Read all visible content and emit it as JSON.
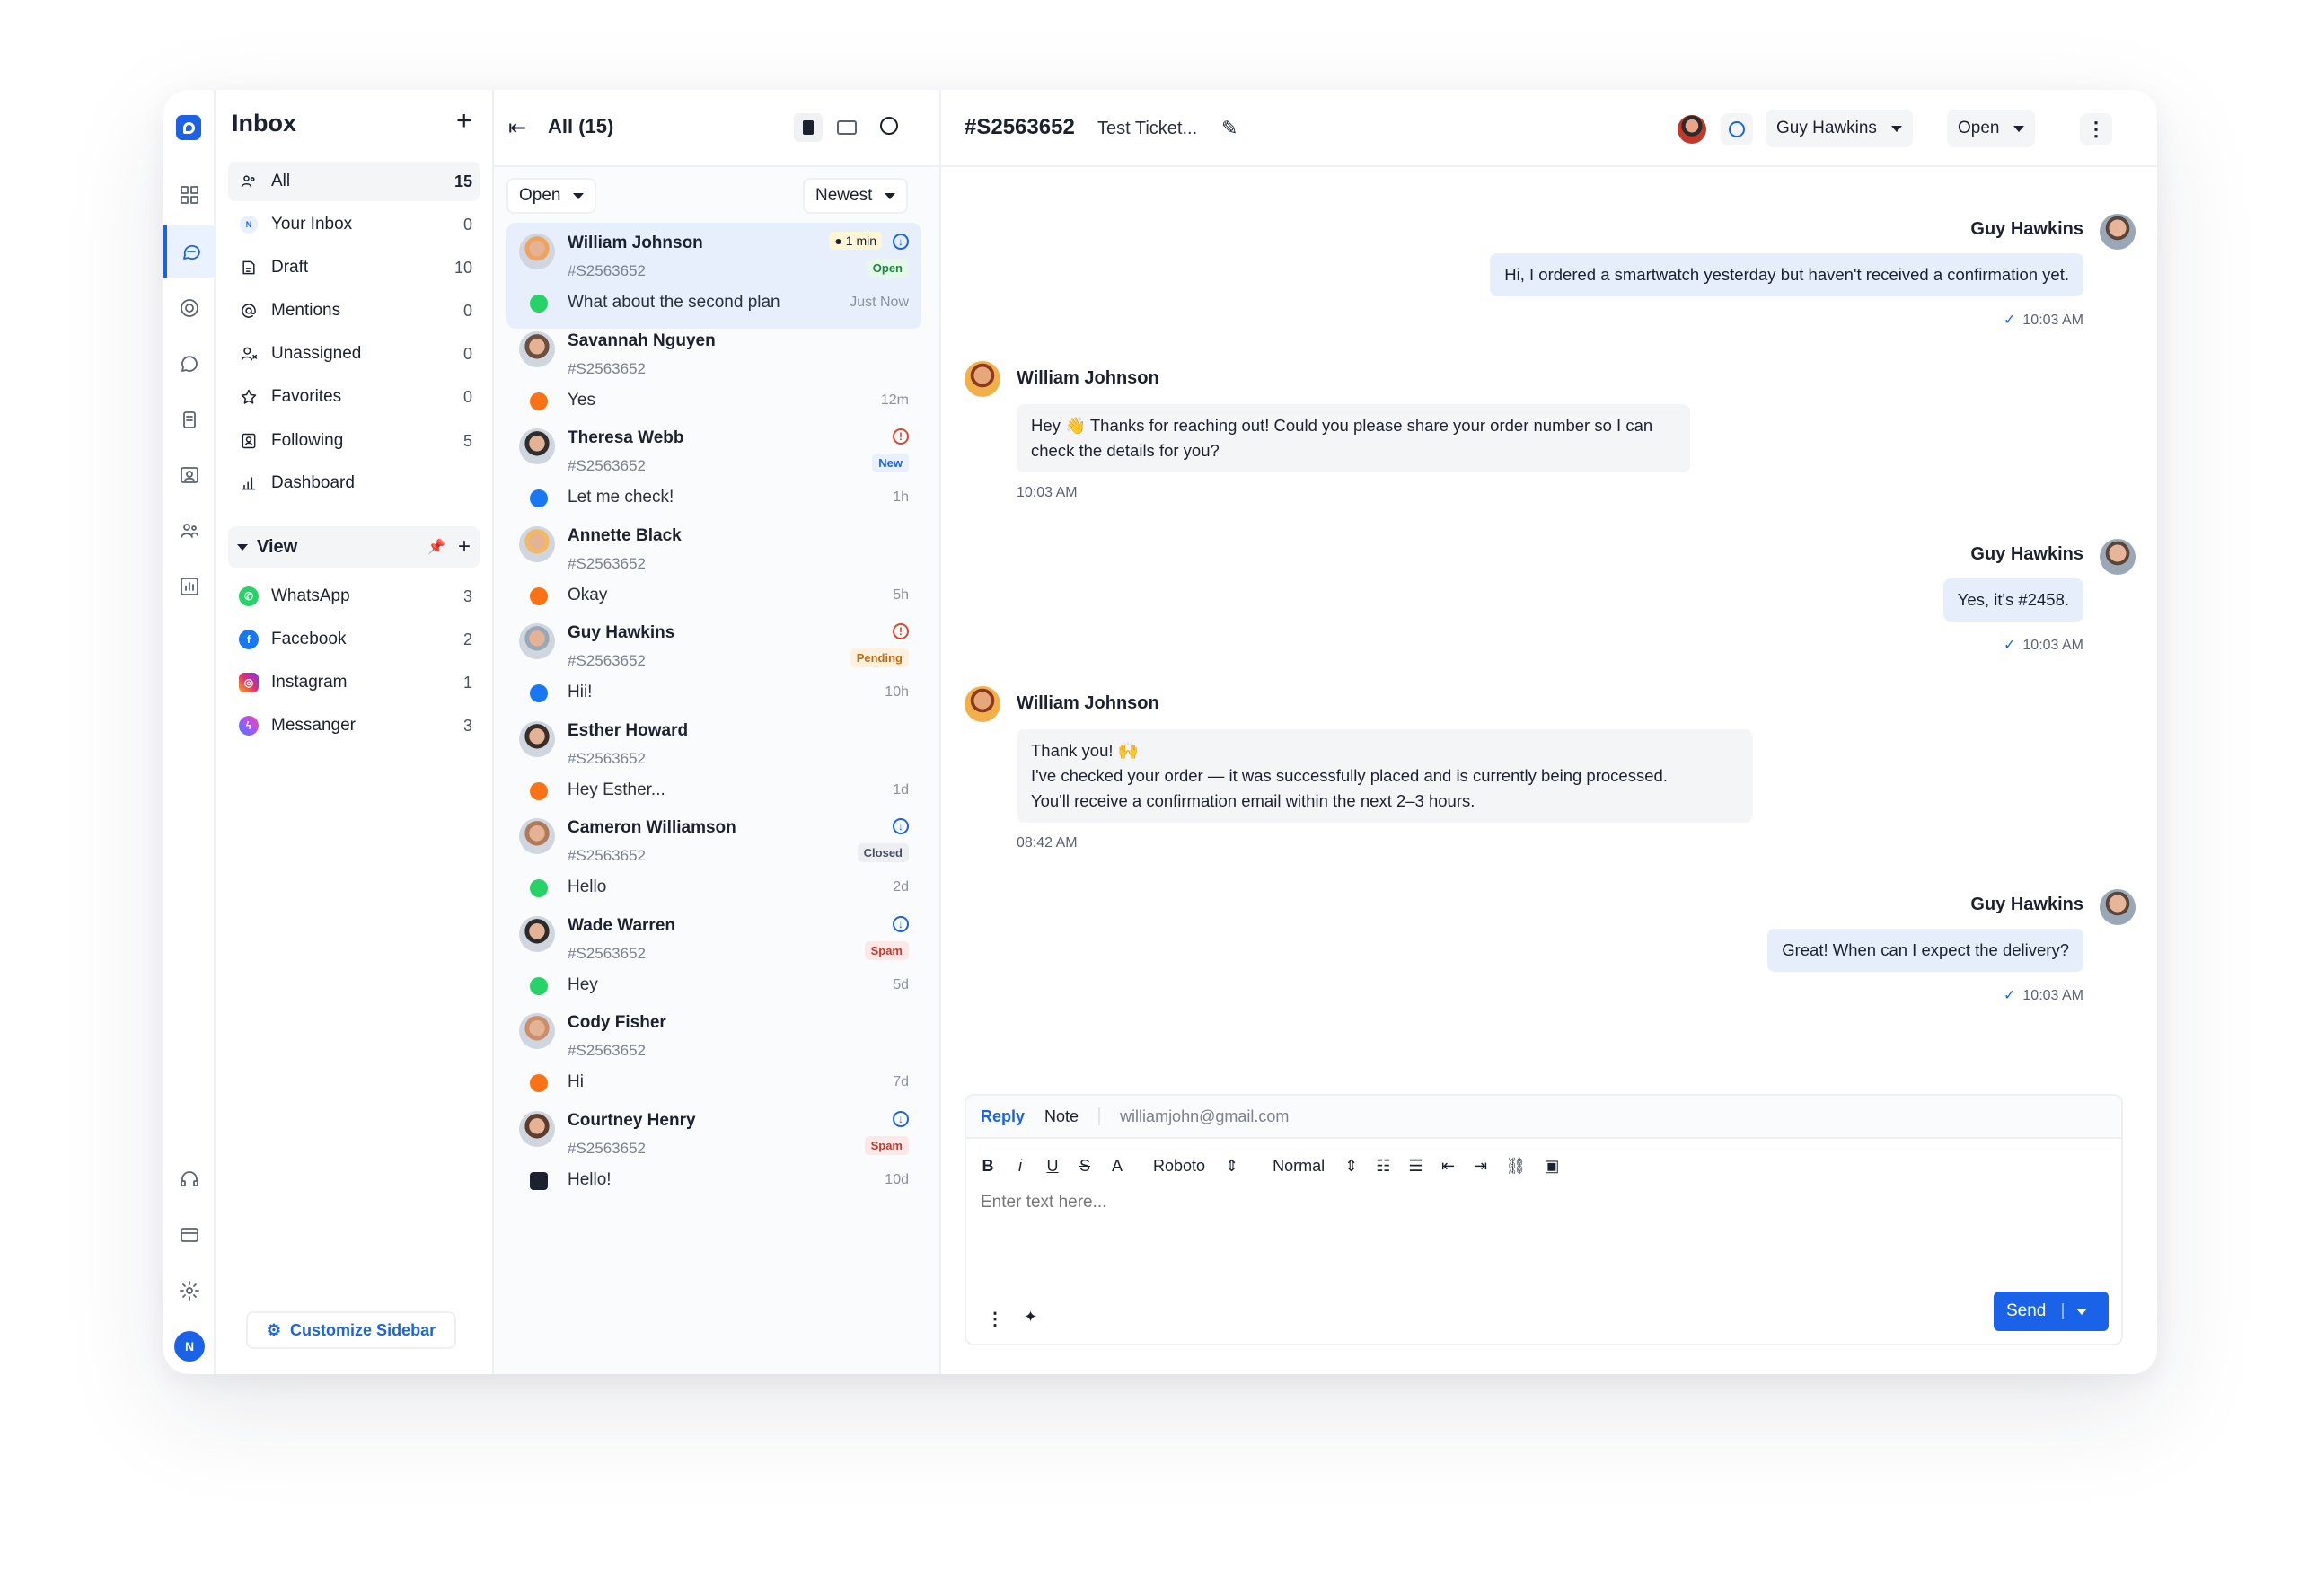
{
  "sidebar": {
    "title": "Inbox",
    "items": [
      {
        "label": "All",
        "count": "15",
        "icon": "users-icon"
      },
      {
        "label": "Your Inbox",
        "count": "0",
        "icon": "n-avatar-icon",
        "avatar_letter": "N"
      },
      {
        "label": "Draft",
        "count": "10",
        "icon": "draft-icon"
      },
      {
        "label": "Mentions",
        "count": "0",
        "icon": "at-icon"
      },
      {
        "label": "Unassigned",
        "count": "0",
        "icon": "unassigned-icon"
      },
      {
        "label": "Favorites",
        "count": "0",
        "icon": "star-icon"
      },
      {
        "label": "Following",
        "count": "5",
        "icon": "following-icon"
      },
      {
        "label": "Dashboard",
        "count": "",
        "icon": "bar-chart-icon"
      }
    ],
    "view_label": "View",
    "channels": [
      {
        "label": "WhatsApp",
        "count": "3",
        "color": "#25d366"
      },
      {
        "label": "Facebook",
        "count": "2",
        "color": "#1877f2"
      },
      {
        "label": "Instagram",
        "count": "1",
        "color": "#e1306c"
      },
      {
        "label": "Messanger",
        "count": "3",
        "color": "#8b5cf6"
      }
    ],
    "customize_label": "Customize Sidebar"
  },
  "list": {
    "title": "All (15)",
    "status_filter": "Open",
    "sort_filter": "Newest",
    "conversations": [
      {
        "name": "William Johnson",
        "id": "#S2563652",
        "message": "What about the second plan",
        "time": "Just Now",
        "badge": "Open",
        "sla": "1 min",
        "channel": "whatsapp"
      },
      {
        "name": "Savannah Nguyen",
        "id": "#S2563652",
        "message": "Yes",
        "time": "12m",
        "badge": "",
        "channel": "chat"
      },
      {
        "name": "Theresa Webb",
        "id": "#S2563652",
        "message": "Let me check!",
        "time": "1h",
        "badge": "New",
        "channel": "facebook"
      },
      {
        "name": "Annette Black",
        "id": "#S2563652",
        "message": "Okay",
        "time": "5h",
        "badge": "",
        "channel": "chat"
      },
      {
        "name": "Guy Hawkins",
        "id": "#S2563652",
        "message": "Hii!",
        "time": "10h",
        "badge": "Pending",
        "channel": "facebook"
      },
      {
        "name": "Esther Howard",
        "id": "#S2563652",
        "message": "Hey Esther...",
        "time": "1d",
        "badge": "",
        "channel": "chat"
      },
      {
        "name": "Cameron Williamson",
        "id": "#S2563652",
        "message": "Hello",
        "time": "2d",
        "badge": "Closed",
        "channel": "whatsapp"
      },
      {
        "name": "Wade Warren",
        "id": "#S2563652",
        "message": "Hey",
        "time": "5d",
        "badge": "Spam",
        "channel": "whatsapp"
      },
      {
        "name": "Cody Fisher",
        "id": "#S2563652",
        "message": "Hi",
        "time": "7d",
        "badge": "",
        "channel": "chat"
      },
      {
        "name": "Courtney Henry",
        "id": "#S2563652",
        "message": "Hello!",
        "time": "10d",
        "badge": "Spam",
        "channel": "email"
      }
    ]
  },
  "chat": {
    "ticket_id": "#S2563652",
    "ticket_name": "Test Ticket...",
    "assignee": "Guy Hawkins",
    "status": "Open",
    "messages": [
      {
        "sender": "Guy Hawkins",
        "text": "Hi, I ordered a smartwatch yesterday but haven't received a confirmation yet.",
        "time": "10:03 AM",
        "direction": "out"
      },
      {
        "sender": "William Johnson",
        "text": "Hey 👋 Thanks for reaching out! Could you please share your order number so I can check the details for you?",
        "time": "10:03 AM",
        "direction": "in"
      },
      {
        "sender": "Guy Hawkins",
        "text": "Yes, it's #2458.",
        "time": "10:03 AM",
        "direction": "out"
      },
      {
        "sender": "William Johnson",
        "text_lines": [
          "Thank you! 🙌",
          "I've checked your order — it was successfully placed and is currently being processed.",
          "You'll receive a confirmation email within the next 2–3 hours."
        ],
        "time": "08:42 AM",
        "direction": "in"
      },
      {
        "sender": "Guy Hawkins",
        "text": "Great! When can I expect the delivery?",
        "time": "10:03 AM",
        "direction": "out"
      }
    ],
    "composer": {
      "tab_reply": "Reply",
      "tab_note": "Note",
      "to_email": "williamjohn@gmail.com",
      "font": "Roboto",
      "size": "Normal",
      "placeholder": "Enter text here...",
      "send_label": "Send"
    }
  },
  "colors": {
    "accent": "#1a63e8",
    "selected_row": "#e7eefc",
    "out_bubble": "#e6eefc"
  }
}
